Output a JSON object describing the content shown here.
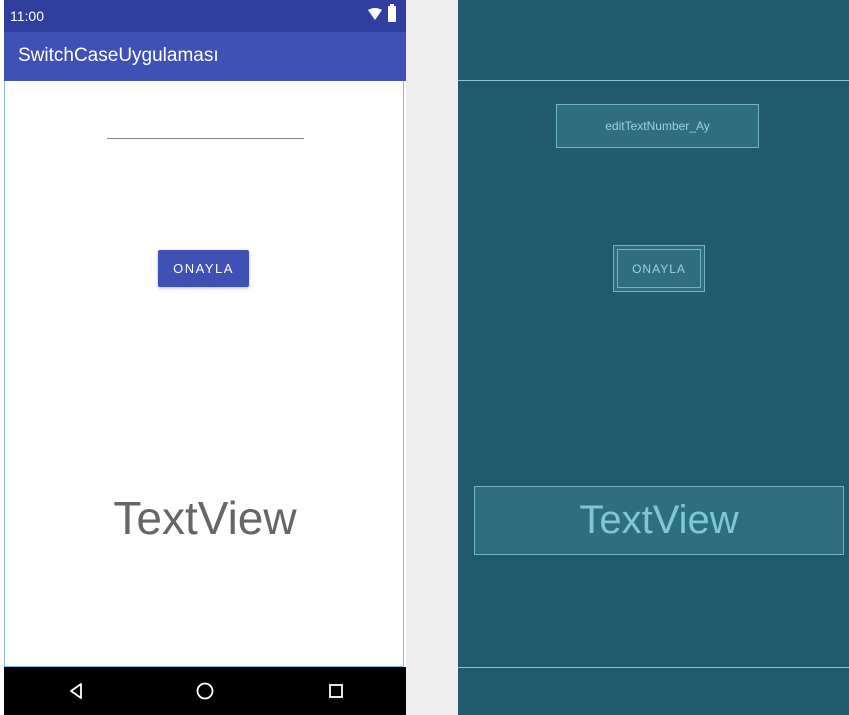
{
  "status_bar": {
    "time": "11:00",
    "wifi_icon": "wifi-icon",
    "battery_icon": "battery-icon"
  },
  "app_bar": {
    "title": "SwitchCaseUygulaması"
  },
  "main": {
    "edit_text": {
      "value": "",
      "placeholder": ""
    },
    "confirm_button": {
      "label": "ONAYLA"
    },
    "text_view": {
      "text": "TextView"
    }
  },
  "nav_bar": {
    "back_icon": "back-icon",
    "home_icon": "home-icon",
    "recents_icon": "recents-icon"
  },
  "blueprint": {
    "edit_text_id": "editTextNumber_Ay",
    "button_label": "ONAYLA",
    "text_view_text": "TextView"
  },
  "colors": {
    "status_bar": "#303f9f",
    "app_bar": "#3f51b5",
    "button": "#3f51b5",
    "blueprint_bg": "#1f5b6c",
    "blueprint_accent": "#9bd0dc"
  }
}
